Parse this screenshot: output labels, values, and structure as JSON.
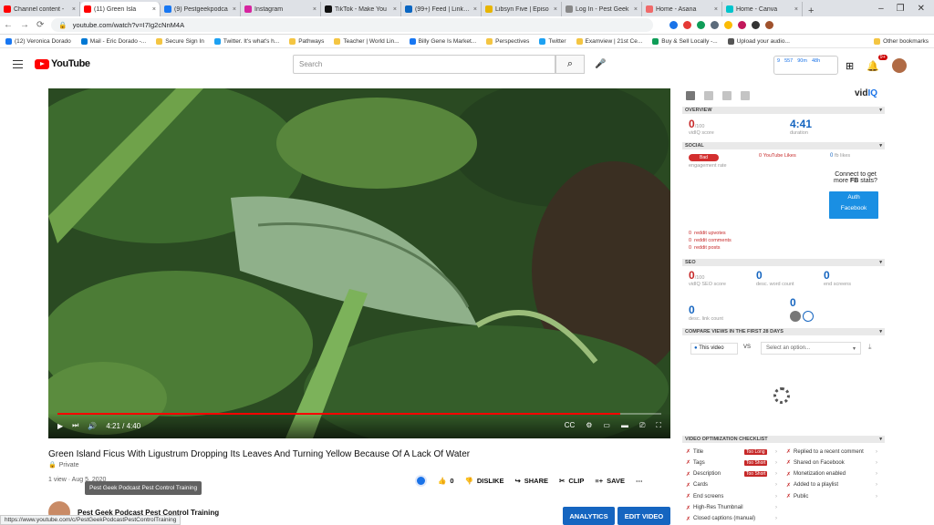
{
  "tabs": [
    {
      "title": "Channel content -",
      "color": "#ff0000",
      "close": "×"
    },
    {
      "title": "(11) Green Isla",
      "color": "#ff0000",
      "close": "×"
    },
    {
      "title": "(9) Pestgeekpodca",
      "color": "#1877f2",
      "close": "×"
    },
    {
      "title": "Instagram",
      "color": "#d6249f",
      "close": "×"
    },
    {
      "title": "TikTok - Make You",
      "color": "#111111",
      "close": "×"
    },
    {
      "title": "(99+) Feed | Linkedi",
      "color": "#0a66c2",
      "close": "×"
    },
    {
      "title": "Libsyn Five | Episo",
      "color": "#e8b500",
      "close": "×"
    },
    {
      "title": "Log In - Pest Geek",
      "color": "#888888",
      "close": "×"
    },
    {
      "title": "Home - Asana",
      "color": "#f06a6a",
      "close": "×"
    },
    {
      "title": "Home - Canva",
      "color": "#00c4cc",
      "close": "×"
    }
  ],
  "newtab": "+",
  "window": {
    "minimize": "–",
    "maximize": "❐",
    "close": "✕"
  },
  "url": "youtube.com/watch?v=I7Ig2cNnM4A",
  "bookmarks": [
    "(12) Veronica Dorado",
    "Mail - Eric Dorado -...",
    "Secure Sign In",
    "Twitter. It's what's h...",
    "Pathways",
    "Teacher | World Lin...",
    "Billy Gene Is Market...",
    "Perspectives",
    "Twitter",
    "Examview | 21st Ce...",
    "Buy & Sell Locally -...",
    "Upload your audio..."
  ],
  "other_bookmarks": "Other bookmarks",
  "yt": {
    "logo": "YouTube",
    "search_placeholder": "Search",
    "notif_count": "9+"
  },
  "vidiq_badge": {
    "a": "9",
    "b": "557",
    "c": "90m",
    "d": "48h"
  },
  "player": {
    "time": "4:21 / 4:40",
    "progress": 0.932,
    "cc": "CC"
  },
  "video": {
    "title": "Green Island Ficus With Ligustrum Dropping Its Leaves And Turning Yellow Because Of A Lack Of Water",
    "privacy": "Private",
    "meta": "1 view · Aug 5, 2020",
    "likes": "0",
    "dislike": "DISLIKE",
    "share": "SHARE",
    "clip": "CLIP",
    "save": "SAVE"
  },
  "tooltip": "Pest Geek Podcast Pest Control Training",
  "channel": {
    "name": "Pest Geek Podcast Pest Control Training"
  },
  "buttons": {
    "analytics": "ANALYTICS",
    "edit": "EDIT VIDEO"
  },
  "status_url": "https://www.youtube.com/c/PestGeekPodcastPestControlTraining",
  "vidiq": {
    "logo_a": "vid",
    "logo_b": "IQ",
    "overview": "Overview",
    "score": "0",
    "score_of": "/100",
    "score_label": "vidIQ score",
    "duration": "4:41",
    "duration_label": "duration",
    "social": "Social",
    "bad": "Bad",
    "engagement": "engagement rate",
    "yt_likes_n": "0",
    "yt_likes": "YouTube Likes",
    "fb_likes_n": "0",
    "fb_likes": "fb likes",
    "fb_connect": "Connect to get more",
    "fb_bold": "FB",
    "fb_stats": "stats?",
    "auth": "Auth",
    "facebook": "Facebook",
    "reddit": [
      {
        "n": "0",
        "t": "reddit upvotes"
      },
      {
        "n": "0",
        "t": "reddit comments"
      },
      {
        "n": "0",
        "t": "reddit posts"
      }
    ],
    "seo": "SEO",
    "seo_score": "0",
    "seo_of": "/100",
    "seo_label": "vidIQ SEO score",
    "desc_words": "0",
    "desc_words_label": "desc. word count",
    "end_screens": "0",
    "end_screens_label": "end screens",
    "desc_links": "0",
    "desc_links_label": "desc. link count",
    "cards": "0",
    "compare": "Compare views in the first 28 days",
    "this_video": "This video",
    "vs": "VS",
    "select": "Select an option...",
    "checklist": "Video optimization checklist",
    "left": [
      {
        "t": "Title",
        "tag": "Too Long"
      },
      {
        "t": "Tags",
        "tag": "Too Short"
      },
      {
        "t": "Description",
        "tag": "Too Short"
      },
      {
        "t": "Cards",
        "tag": ""
      },
      {
        "t": "End screens",
        "tag": ""
      },
      {
        "t": "High-Res Thumbnail",
        "tag": ""
      },
      {
        "t": "Closed captions (manual)",
        "tag": ""
      }
    ],
    "right": [
      "Replied to a recent comment",
      "Shared on Facebook",
      "Monetization enabled",
      "Added to a playlist",
      "Public"
    ]
  }
}
